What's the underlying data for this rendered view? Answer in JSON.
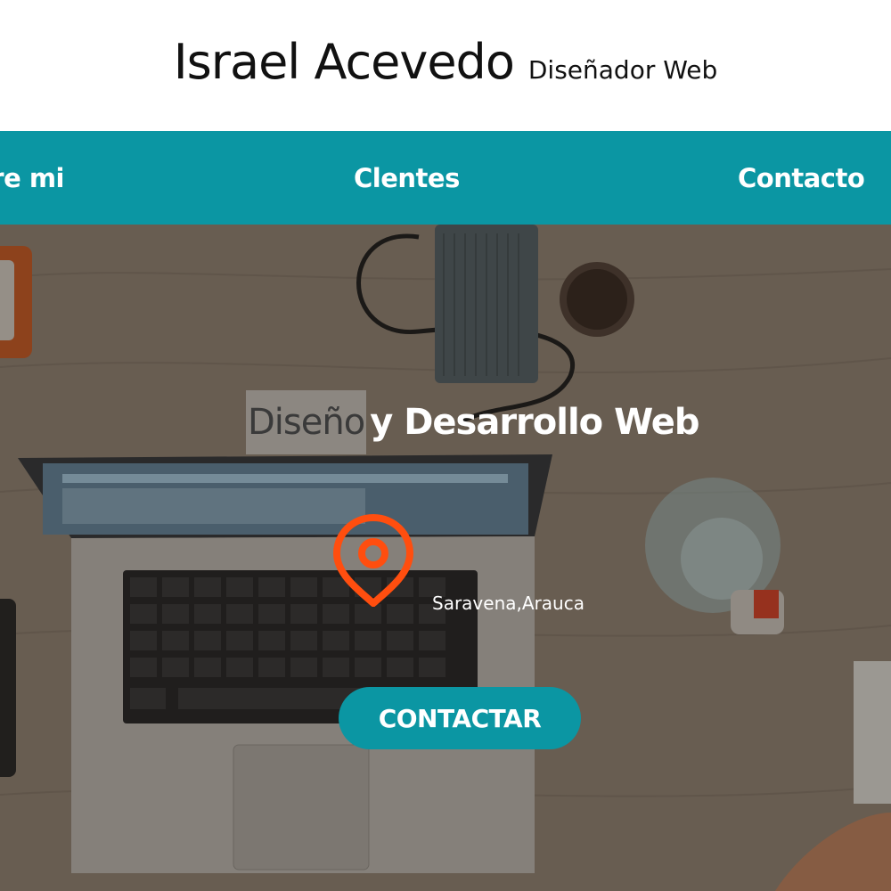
{
  "header": {
    "name": "Israel Acevedo",
    "role": "Diseñador Web"
  },
  "nav": {
    "items": [
      {
        "label": "Sobre mi"
      },
      {
        "label": "Clentes"
      },
      {
        "label": "Contacto"
      }
    ]
  },
  "hero": {
    "title_highlight": "Diseño",
    "title_rest": "y Desarrollo Web",
    "location": "Saravena,Arauca",
    "cta_label": "CONTACTAR",
    "pin_icon": "map-pin-icon"
  },
  "colors": {
    "accent": "#0b96a3",
    "pin": "#ff4e0f",
    "header_bg": "#ffffff",
    "text_dark": "#111111"
  }
}
